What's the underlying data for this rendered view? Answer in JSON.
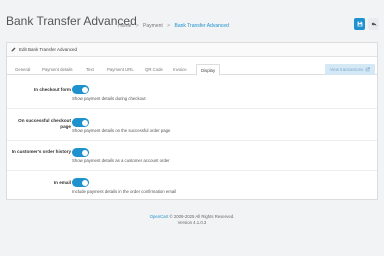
{
  "header": {
    "title": "Bank Transfer Advanced",
    "breadcrumbs": [
      {
        "label": "Home"
      },
      {
        "label": "Payment"
      },
      {
        "label": "Bank Transfer Advanced"
      }
    ],
    "breadcrumb_separator": ">",
    "save_icon": "save-icon",
    "back_icon": "reply-icon",
    "accent_color": "#1e91cf"
  },
  "panel": {
    "heading": "Edit Bank Transfer Advanced",
    "heading_icon": "pencil-icon",
    "tabs": [
      {
        "label": "General"
      },
      {
        "label": "Payment details"
      },
      {
        "label": "Text"
      },
      {
        "label": "Payment URL"
      },
      {
        "label": "QR Code"
      },
      {
        "label": "Invoice"
      },
      {
        "label": "Display"
      }
    ],
    "active_tab": "Display",
    "view_transactions_label": "View transactions",
    "rows": [
      {
        "label": "In checkout form",
        "enabled": true,
        "help": "Show payment details during checkout"
      },
      {
        "label": "On successful checkout page",
        "enabled": true,
        "help": "Show payment details on the successful order page"
      },
      {
        "label": "In customer's order history",
        "enabled": true,
        "help": "Show payment details as a customer account order"
      },
      {
        "label": "In email",
        "enabled": true,
        "help": "Include payment details in the order confirmation email"
      }
    ]
  },
  "footer": {
    "brand": "OpenCart",
    "copyright": "© 2009-2025 All Rights Reserved.",
    "version": "Version 4.1.0.3"
  }
}
